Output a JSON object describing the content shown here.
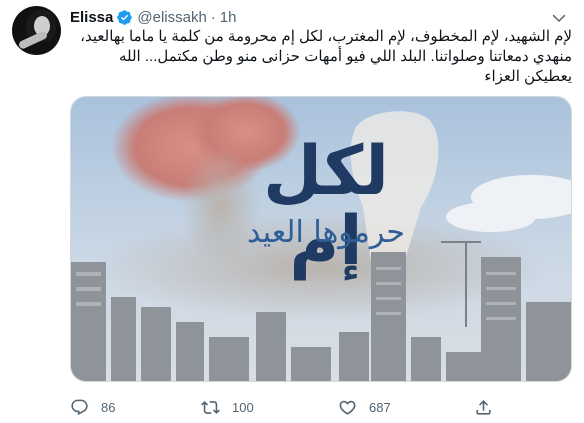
{
  "tweet": {
    "author_name": "Elissa",
    "handle": "@elissakh",
    "separator": "·",
    "time": "1h",
    "text_lines": [
      "لإم الشهيد، لإم المخطوف، لإم المغترب، لكل إم محرومة من كلمة يا ماما بهالعيد،",
      "منهدي دمعاتنا وصلواتنا. البلد اللي فيو أمهات حزانى منو وطن مكتمل... الله",
      "يعطيكن العزاء"
    ]
  },
  "media": {
    "headline": "لكل إم",
    "subtitle": "حرموها العيد"
  },
  "actions": {
    "replies": "86",
    "retweets": "100",
    "likes": "687"
  },
  "icons": {
    "avatar": "avatar-photo",
    "verified": "verified-badge-icon",
    "more": "chevron-down-icon",
    "reply": "reply-icon",
    "retweet": "retweet-icon",
    "like": "heart-icon",
    "share": "share-icon"
  },
  "colors": {
    "verified": "#1d9bf0",
    "secondary_text": "#536471",
    "headline_text": "#1f3a63",
    "subtitle_text": "#2e5e96"
  }
}
